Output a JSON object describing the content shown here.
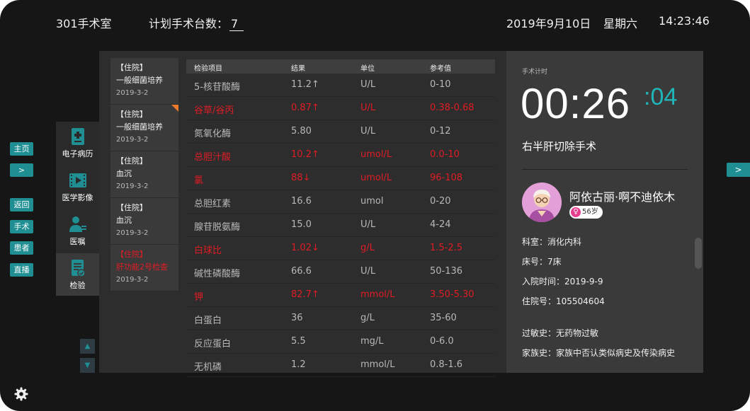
{
  "header": {
    "room": "301手术室",
    "plan_label": "计划手术台数：",
    "plan_count": "7",
    "date": "2019年9月10日",
    "weekday": "星期六",
    "time": "14:23:46"
  },
  "left_buttons": {
    "home": "主页",
    "next": ">",
    "back": "返回",
    "surgery": "手术",
    "patient": "患者",
    "live": "直播"
  },
  "right_button": ">",
  "tools": [
    {
      "label": "电子病历",
      "icon": "medical-record-icon"
    },
    {
      "label": "医学影像",
      "icon": "video-icon"
    },
    {
      "label": "医嘱",
      "icon": "doctor-icon"
    },
    {
      "label": "检验",
      "icon": "report-icon"
    }
  ],
  "records": [
    {
      "type": "【住院】",
      "name": "一般细菌培养",
      "date": "2019-3-2",
      "abnormal": false,
      "flag": false
    },
    {
      "type": "【住院】",
      "name": "一般细菌培养",
      "date": "2019-3-2",
      "abnormal": false,
      "flag": true
    },
    {
      "type": "【住院】",
      "name": "血沉",
      "date": "2019-3-2",
      "abnormal": false,
      "flag": false
    },
    {
      "type": "【住院】",
      "name": "血沉",
      "date": "2019-3-2",
      "abnormal": false,
      "flag": false
    },
    {
      "type": "【住院】",
      "name": "肝功能2号检查",
      "date": "2019-3-2",
      "abnormal": true,
      "flag": false
    }
  ],
  "lab_table": {
    "headers": [
      "检验项目",
      "结果",
      "单位",
      "参考值"
    ],
    "rows": [
      {
        "item": "5-核苷酸酶",
        "result": "11.2↑",
        "unit": "U/L",
        "ref": "0-10",
        "abnormal": false
      },
      {
        "item": "谷草/谷丙",
        "result": "0.87↑",
        "unit": "U/L",
        "ref": "0.38-0.68",
        "abnormal": true
      },
      {
        "item": "氮氧化酶",
        "result": "5.80",
        "unit": "U/L",
        "ref": "0-12",
        "abnormal": false
      },
      {
        "item": "总胆汁酸",
        "result": "10.2↑",
        "unit": "umol/L",
        "ref": "0.0-10",
        "abnormal": true
      },
      {
        "item": "氯",
        "result": "88↓",
        "unit": "umol/L",
        "ref": "96-108",
        "abnormal": true
      },
      {
        "item": "总胆红素",
        "result": "16.6",
        "unit": "umol",
        "ref": "0-20",
        "abnormal": false
      },
      {
        "item": "腺苷脱氨酶",
        "result": "15.0",
        "unit": "U/L",
        "ref": "4-24",
        "abnormal": false
      },
      {
        "item": "白球比",
        "result": "1.02↓",
        "unit": "g/L",
        "ref": "1.5-2.5",
        "abnormal": true
      },
      {
        "item": "碱性磷酸酶",
        "result": "66.6",
        "unit": "U/L",
        "ref": "50-136",
        "abnormal": false
      },
      {
        "item": "钾",
        "result": "82.7↑",
        "unit": "mmol/L",
        "ref": "3.50-5.30",
        "abnormal": true
      },
      {
        "item": "白蛋白",
        "result": "36",
        "unit": "g/L",
        "ref": "35-60",
        "abnormal": false
      },
      {
        "item": "反应蛋白",
        "result": "5.5",
        "unit": "mg/L",
        "ref": "0-6.0",
        "abnormal": false
      },
      {
        "item": "无机磷",
        "result": "1.2",
        "unit": "mmol/L",
        "ref": "0.8-1.6",
        "abnormal": false
      }
    ]
  },
  "timer": {
    "label": "手术计时",
    "main": "00:26",
    "seconds": ":04"
  },
  "operation": "右半肝切除手术",
  "patient": {
    "name": "阿依古丽·啊不迪依木",
    "sex_symbol": "♀",
    "age": "56岁",
    "dept": "科室：消化内科",
    "bed": "床号：7床",
    "admit": "入院时间：2019-9-9",
    "admit_no": "住院号：105504604",
    "allergy": "过敏史：无药物过敏",
    "family": "家族史：家族中否认类似病史及传染病史"
  },
  "colors": {
    "accent": "#1f8f93",
    "abnormal": "#e01c25",
    "timer_seconds": "#1fb6ba",
    "flag": "#ea7a2d"
  }
}
